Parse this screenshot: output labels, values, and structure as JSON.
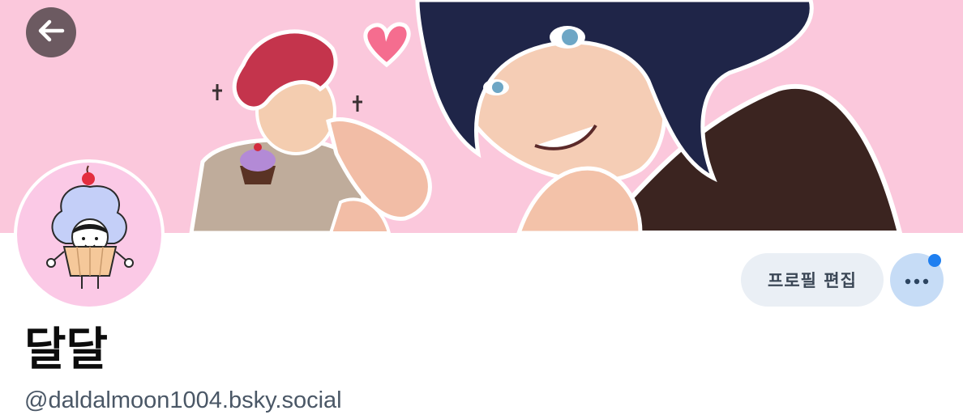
{
  "colors": {
    "banner_bg": "#fbc8dc",
    "accent_blue": "#1f7ff0",
    "edit_button_bg": "#eaeff5",
    "more_button_bg": "#c6dcf6",
    "handle_text": "#4a5766"
  },
  "icons": {
    "back": "arrow-left-icon",
    "more": "more-dots-icon",
    "notification": "notification-dot"
  },
  "profile": {
    "display_name": "달달",
    "handle": "@daldalmoon1004.bsky.social"
  },
  "actions": {
    "edit_profile_label": "프로필 편집"
  }
}
